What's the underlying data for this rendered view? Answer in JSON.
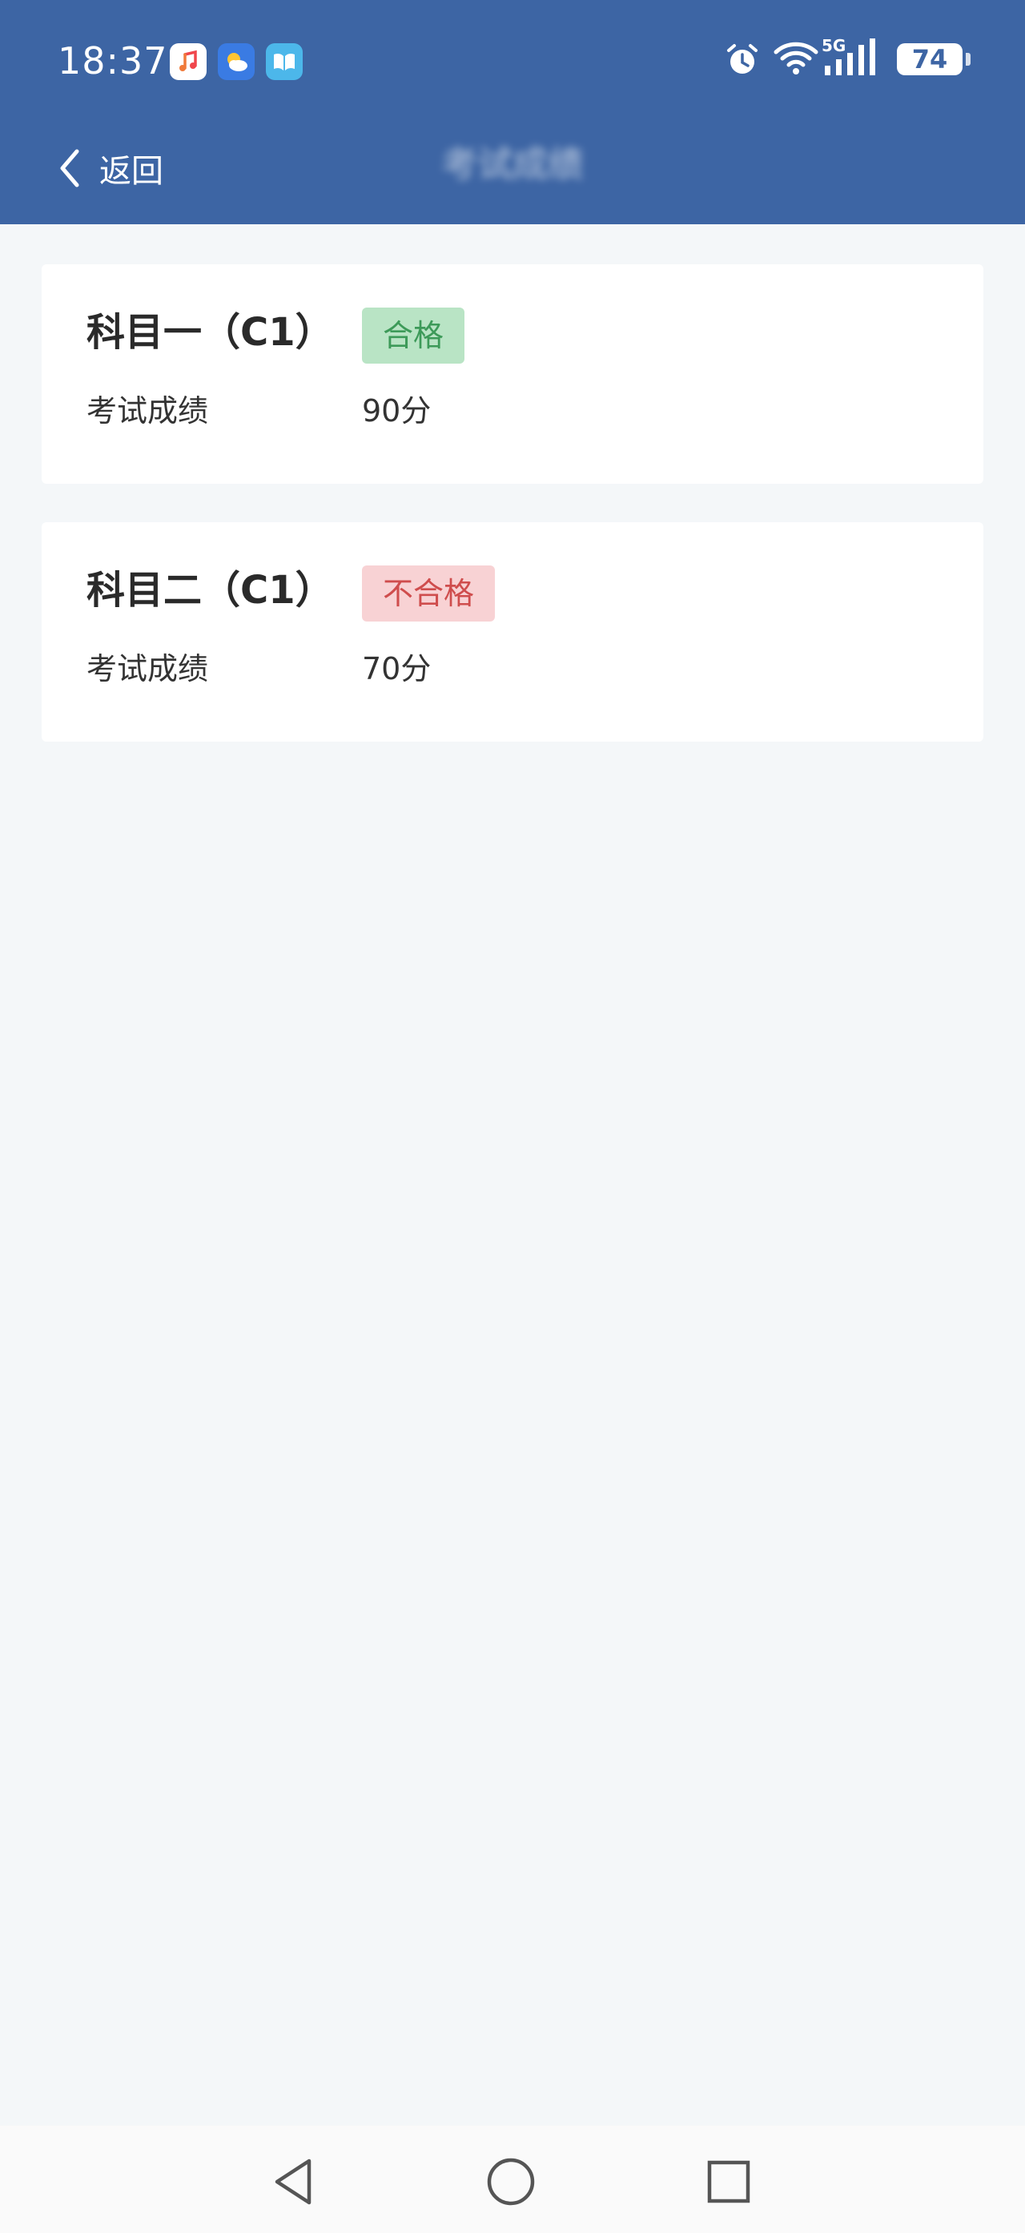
{
  "status_bar": {
    "time": "18:37",
    "battery": "74",
    "network": "5G"
  },
  "nav": {
    "back_label": "返回",
    "title": "考试成绩"
  },
  "results": [
    {
      "subject": "科目一（C1）",
      "status": "合格",
      "score_label": "考试成绩",
      "score": "90分"
    },
    {
      "subject": "科目二（C1）",
      "status": "不合格",
      "score_label": "考试成绩",
      "score": "70分"
    }
  ],
  "colors": {
    "header": "#3d65a4",
    "background": "#f4f7f9",
    "pass_bg": "#b9e4c5",
    "pass_text": "#3d9a59",
    "fail_bg": "#f8d2d4",
    "fail_text": "#cf4d4d"
  },
  "icons": {
    "status_apps": [
      "music-app-icon",
      "weather-app-icon",
      "reader-app-icon"
    ],
    "status_right": [
      "alarm-icon",
      "wifi-icon",
      "cellular-signal-icon",
      "battery-icon"
    ],
    "system_nav": [
      "back-triangle-icon",
      "home-circle-icon",
      "recents-square-icon"
    ]
  }
}
